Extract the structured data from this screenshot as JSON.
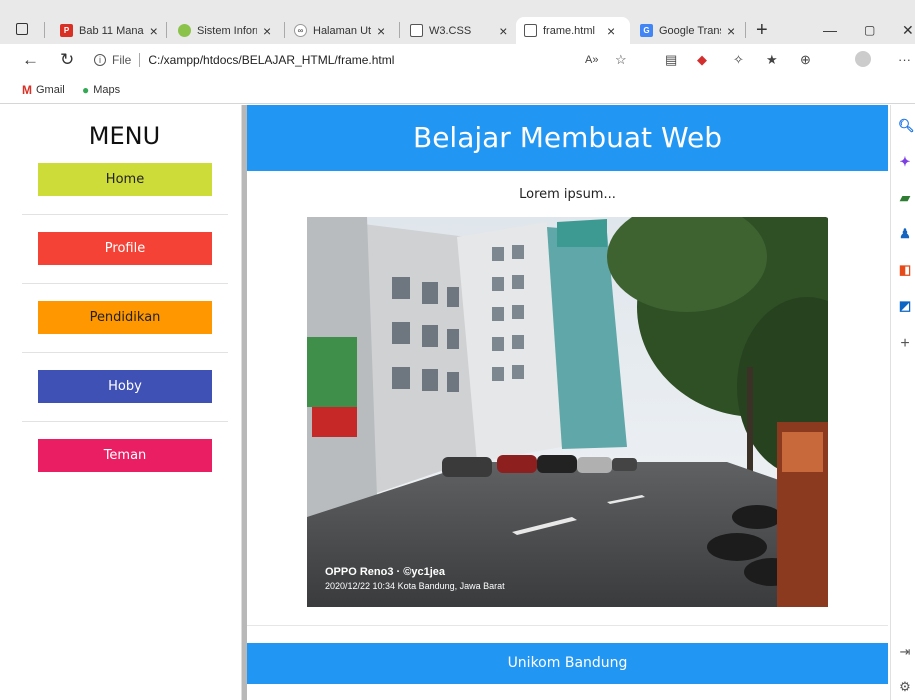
{
  "browser": {
    "tabs": [
      {
        "title": "Bab 11 Mana",
        "active": false
      },
      {
        "title": "Sistem Inforr",
        "active": false
      },
      {
        "title": "Halaman Uta",
        "active": false
      },
      {
        "title": "W3.CSS",
        "active": false
      },
      {
        "title": "frame.html",
        "active": true
      },
      {
        "title": "Google Trans",
        "active": false
      }
    ],
    "tab_close_glyph": "×",
    "new_tab_glyph": "+",
    "address": {
      "scheme_label": "File",
      "url": "C:/xampp/htdocs/BELAJAR_HTML/frame.html"
    },
    "bookmarks": [
      {
        "label": "Gmail",
        "icon": "gmail-icon"
      },
      {
        "label": "Maps",
        "icon": "maps-pin-icon"
      }
    ]
  },
  "menu_frame": {
    "title": "MENU",
    "items": [
      {
        "label": "Home",
        "bg": "#cddc39",
        "fg": "#222222"
      },
      {
        "label": "Profile",
        "bg": "#f44336",
        "fg": "#ffffff"
      },
      {
        "label": "Pendidikan",
        "bg": "#ff9800",
        "fg": "#222222"
      },
      {
        "label": "Hoby",
        "bg": "#3f51b5",
        "fg": "#ffffff"
      },
      {
        "label": "Teman",
        "bg": "#e91e63",
        "fg": "#ffffff"
      }
    ]
  },
  "content_frame": {
    "header": "Belajar Membuat Web",
    "intro": "Lorem ipsum...",
    "photo": {
      "watermark_line1": "OPPO Reno3 · ©yc1jea",
      "watermark_line2": "2020/12/22 10:34  Kota Bandung, Jawa Barat"
    },
    "footer": "Unikom Bandung"
  },
  "colors": {
    "accent_blue": "#2196f3"
  }
}
